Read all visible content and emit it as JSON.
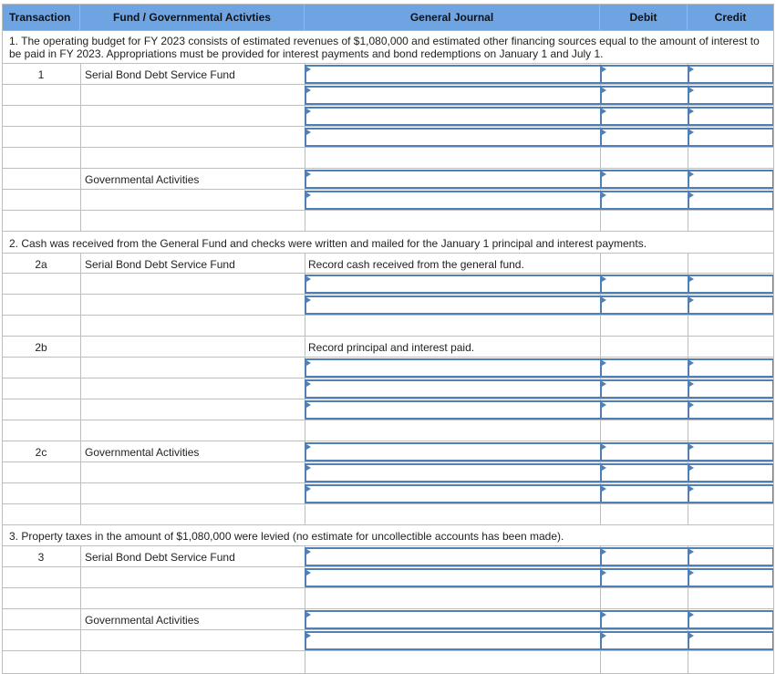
{
  "header": {
    "transaction": "Transaction",
    "fund": "Fund / Governmental Activties",
    "journal": "General Journal",
    "debit": "Debit",
    "credit": "Credit"
  },
  "narratives": {
    "n1": "1. The operating budget for FY 2023 consists of estimated revenues of $1,080,000 and estimated other financing sources equal to the amount of interest to be paid in FY 2023. Appropriations must be provided for interest payments and bond redemptions on January 1 and July 1.",
    "n2": "2. Cash was received from the General Fund and checks were written and mailed for the January 1 principal and interest payments.",
    "n3": "3. Property taxes in the amount of $1,080,000 were levied (no estimate for uncollectible accounts has been made)."
  },
  "rows": {
    "t1": "1",
    "t2a": "2a",
    "t2b": "2b",
    "t2c": "2c",
    "t3": "3",
    "serial_bond_fund": "Serial Bond Debt Service Fund",
    "gov_activities": "Governmental Activities",
    "cash_received_note": "Record cash received from the general fund.",
    "principal_interest_note": "Record principal and interest paid."
  }
}
